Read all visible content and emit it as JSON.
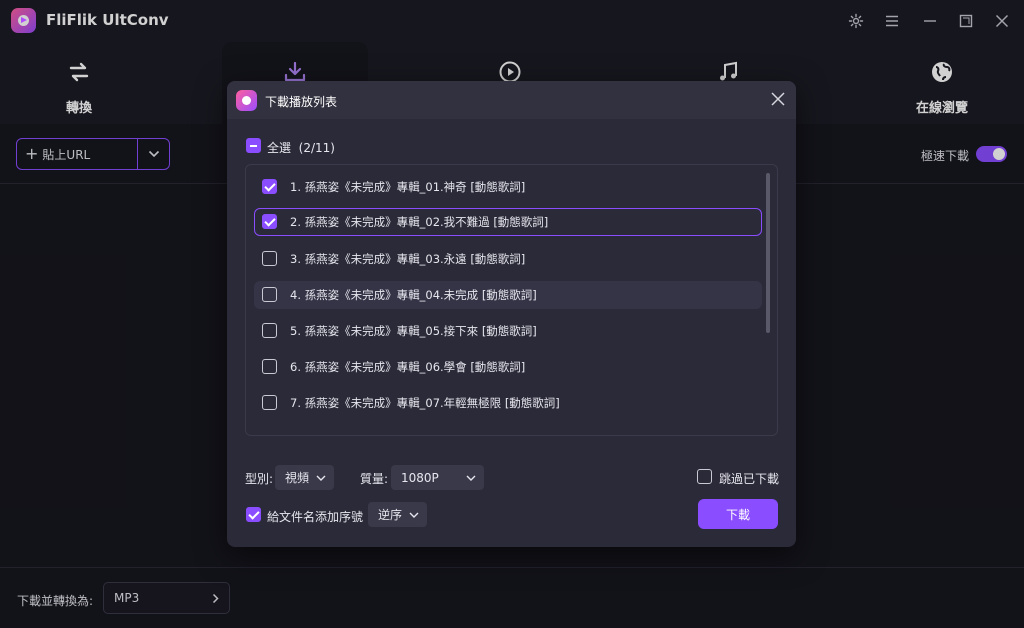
{
  "app": {
    "title": "FliFlik UltConv"
  },
  "window_controls": [
    "gear-icon",
    "menu-icon",
    "minimize-icon",
    "maximize-icon",
    "close-icon"
  ],
  "nav": {
    "tabs": [
      {
        "label": "轉換",
        "icon": "swap-icon"
      },
      {
        "label": "",
        "icon": "download-icon",
        "active": true
      },
      {
        "label": "",
        "icon": "play-circle-icon"
      },
      {
        "label": "",
        "icon": "music-note-icon"
      },
      {
        "label": "在線瀏覽",
        "icon": "globe-icon"
      }
    ]
  },
  "toolbar": {
    "paste_url": "貼上URL",
    "turbo_download": "極速下載",
    "turbo_on": true
  },
  "footer": {
    "convert_label": "下載並轉換為:",
    "format": "MP3"
  },
  "dialog": {
    "title": "下載播放列表",
    "select_all_label": "全選",
    "select_count": "(2/11)",
    "items": [
      {
        "label": "1. 孫燕姿《未完成》專輯_01.神奇 [動態歌詞]",
        "checked": true
      },
      {
        "label": "2. 孫燕姿《未完成》專輯_02.我不難過 [動態歌詞]",
        "checked": true
      },
      {
        "label": "3. 孫燕姿《未完成》專輯_03.永遠 [動態歌詞]",
        "checked": false
      },
      {
        "label": "4. 孫燕姿《未完成》專輯_04.未完成 [動態歌詞]",
        "checked": false
      },
      {
        "label": "5. 孫燕姿《未完成》專輯_05.接下來 [動態歌詞]",
        "checked": false
      },
      {
        "label": "6. 孫燕姿《未完成》專輯_06.學會 [動態歌詞]",
        "checked": false
      },
      {
        "label": "7. 孫燕姿《未完成》專輯_07.年輕無極限 [動態歌詞]",
        "checked": false
      }
    ],
    "type_label": "型別:",
    "type_value": "視頻",
    "quality_label": "質量:",
    "quality_value": "1080P",
    "skip_downloaded": "跳過已下載",
    "add_index_label": "給文件名添加序號",
    "order_value": "逆序",
    "download_button": "下載"
  },
  "colors": {
    "accent": "#8a4dff",
    "background": "#17161f",
    "panel": "#2b2a38"
  }
}
